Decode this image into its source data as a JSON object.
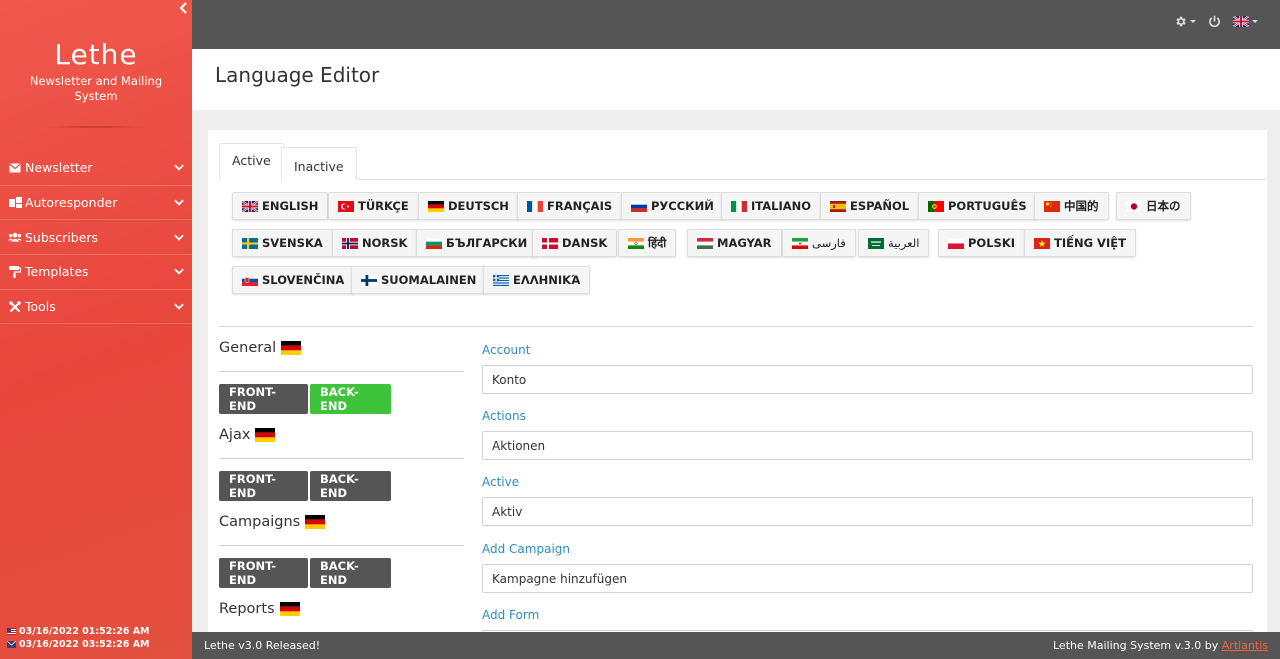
{
  "brand": {
    "title": "Lethe",
    "subtitle": "Newsletter and Mailing System"
  },
  "sidebar": {
    "items": [
      {
        "label": "Newsletter",
        "icon": "envelope-icon"
      },
      {
        "label": "Autoresponder",
        "icon": "autoresponder-icon"
      },
      {
        "label": "Subscribers",
        "icon": "users-icon"
      },
      {
        "label": "Templates",
        "icon": "paint-roller-icon"
      },
      {
        "label": "Tools",
        "icon": "wrench-icon"
      }
    ],
    "times": [
      "03/16/2022 01:52:26 AM",
      "03/16/2022 03:52:26 AM"
    ]
  },
  "page": {
    "title": "Language Editor"
  },
  "tabs": [
    {
      "label": "Active"
    },
    {
      "label": "Inactive"
    }
  ],
  "languages": [
    {
      "label": "ENGLISH"
    },
    {
      "label": "TÜRKÇE"
    },
    {
      "label": "DEUTSCH"
    },
    {
      "label": "FRANÇAIS"
    },
    {
      "label": "РУССКИЙ"
    },
    {
      "label": "ITALIANO"
    },
    {
      "label": "ESPAÑOL"
    },
    {
      "label": "PORTUGUÊS"
    },
    {
      "label": "中国的"
    },
    {
      "label": "日本の"
    },
    {
      "label": "SVENSKA"
    },
    {
      "label": "NORSK"
    },
    {
      "label": "БЪЛГАРСКИ"
    },
    {
      "label": "DANSK"
    },
    {
      "label": "हिंदी"
    },
    {
      "label": "MAGYAR"
    },
    {
      "label": "فارسی"
    },
    {
      "label": "العربية"
    },
    {
      "label": "POLSKI"
    },
    {
      "label": "TIẾNG VIỆT"
    },
    {
      "label": "SLOVENČINA"
    },
    {
      "label": "SUOMALAINEN"
    },
    {
      "label": "ΕΛΛΗΝΙΚΆ"
    }
  ],
  "sections": [
    {
      "title": "General",
      "front": "FRONT-END",
      "back": "BACK-END"
    },
    {
      "title": "Ajax",
      "front": "FRONT-END",
      "back": "BACK-END"
    },
    {
      "title": "Campaigns",
      "front": "FRONT-END",
      "back": "BACK-END"
    },
    {
      "title": "Reports"
    }
  ],
  "fields": [
    {
      "label": "Account",
      "value": "Konto"
    },
    {
      "label": "Actions",
      "value": "Aktionen"
    },
    {
      "label": "Active",
      "value": "Aktiv"
    },
    {
      "label": "Add Campaign",
      "value": "Kampagne hinzufügen"
    },
    {
      "label": "Add Form",
      "value": ""
    }
  ],
  "footer": {
    "left": "Lethe v3.0 Released!",
    "right_prefix": "Lethe Mailing System v.3.0 by",
    "right_link": "Artlantis"
  },
  "colors": {
    "sidebar": "#e8463b",
    "accent_link": "#2d8dbf",
    "active_button": "#3ec43b",
    "dark_button": "#555555"
  }
}
